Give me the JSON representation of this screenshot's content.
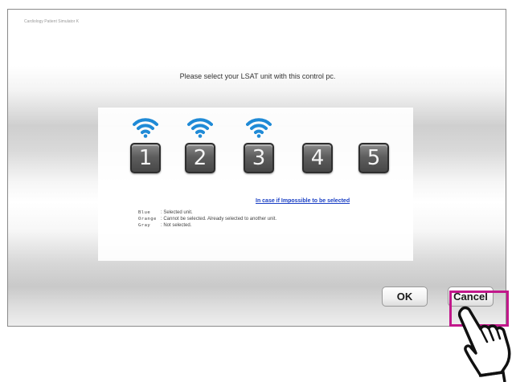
{
  "window": {
    "title": "Cardiology Patient Simulator K"
  },
  "dialog": {
    "prompt": "Please select your LSAT unit with this control pc.",
    "units": [
      {
        "number": "1",
        "status": "selected",
        "wifi_visible": true
      },
      {
        "number": "2",
        "status": "selected",
        "wifi_visible": true
      },
      {
        "number": "3",
        "status": "selected",
        "wifi_visible": true
      },
      {
        "number": "4",
        "status": "not-selected",
        "wifi_visible": false
      },
      {
        "number": "5",
        "status": "not-selected",
        "wifi_visible": false
      }
    ],
    "help_link": "In case if Impossible to be selected",
    "legend": [
      {
        "key": "Blue",
        "desc": ": Selected unit."
      },
      {
        "key": "Orange",
        "desc": ": Cannot be selected. Already selected to another unit."
      },
      {
        "key": "Gray",
        "desc": ": Not selected."
      }
    ]
  },
  "buttons": {
    "ok": "OK",
    "cancel": "Cancel"
  },
  "annotation": {
    "highlighted_button": "cancel",
    "highlight_color": "#c2188b",
    "pointer": "hand-pointer-icon"
  },
  "colors": {
    "wifi_selected": "#1f8ad6",
    "tile_gray": "#5e5e5e",
    "link_blue": "#1a3fc4"
  }
}
